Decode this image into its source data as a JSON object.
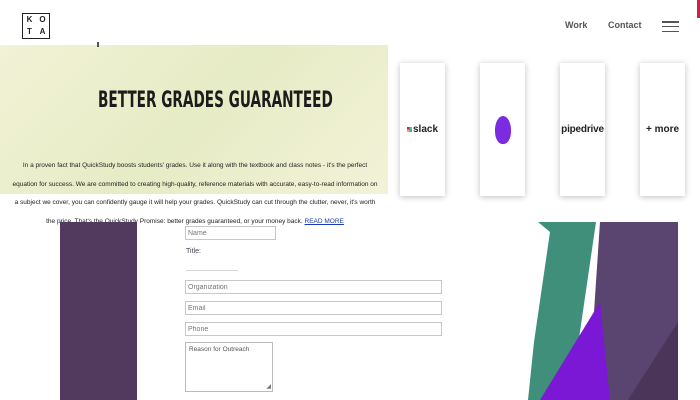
{
  "header": {
    "logo_letters": [
      "K",
      "O",
      "T",
      "A"
    ],
    "nav": {
      "work": "Work",
      "contact": "Contact"
    }
  },
  "banner": {
    "title": "BETTER GRADES GUARANTEED",
    "body": "In a proven fact that QuickStudy boosts students' grades. Use it along with the textbook and class notes - it's the perfect equation for success. We are committed to creating high-quality, reference materials with accurate, easy-to-read information on a subject we cover, you can confidently gauge it will help your grades. QuickStudy can cut through the clutter, never, it's worth the price. That's the QuickStudy Promise: better grades guaranteed, or your money back.",
    "link": "READ MORE"
  },
  "integrations": [
    {
      "name": "slack-card",
      "label": "slack"
    },
    {
      "name": "purple-blob-card",
      "label": ""
    },
    {
      "name": "pipedrive-card",
      "label": "pipedrive"
    },
    {
      "name": "more-card",
      "label": "+ more"
    }
  ],
  "form": {
    "name_placeholder": "Name",
    "title_label": "Title:",
    "organization_placeholder": "Organization",
    "email_placeholder": "Email",
    "phone_placeholder": "Phone",
    "reason_placeholder": "Reason for Outreach"
  },
  "colors": {
    "accent_purple": "#523a5f",
    "accent_teal": "#3f8f7a",
    "accent_violet": "#7a18d6",
    "link_blue": "#1a39b5"
  }
}
